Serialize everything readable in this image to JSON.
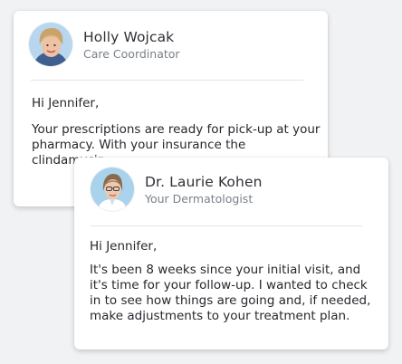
{
  "messages": [
    {
      "sender_name": "Holly Wojcak",
      "sender_role": "Care Coordinator",
      "greeting": "Hi Jennifer,",
      "body": "Your prescriptions are ready for pick-up at your pharmacy. With your insurance the clindamycin…"
    },
    {
      "sender_name": "Dr. Laurie Kohen",
      "sender_role": "Your Dermatologist",
      "greeting": "Hi Jennifer,",
      "body": "It's been 8 weeks since your initial visit, and it's time for your follow-up. I wanted to check in to see how things are going and, if needed, make adjustments to your treatment plan."
    }
  ]
}
